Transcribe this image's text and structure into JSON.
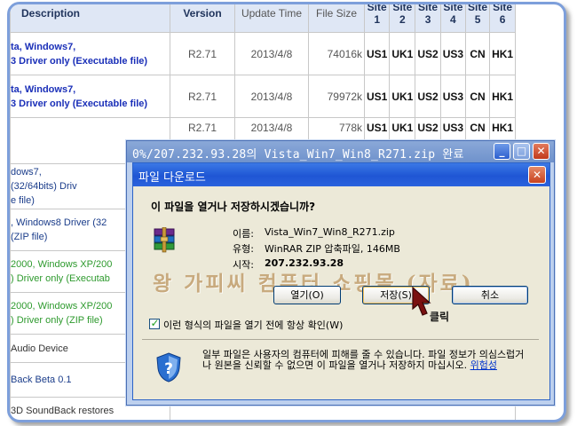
{
  "table": {
    "headers": {
      "description": "Description",
      "version": "Version",
      "date": "Update Time",
      "size": "File Size",
      "sites": [
        "Site 1",
        "Site 2",
        "Site 3",
        "Site 4",
        "Site 5",
        "Site 6"
      ]
    },
    "rows": [
      {
        "desc1": "ta, Windows7,",
        "desc2": "3 Driver only (Executable file)",
        "version": "R2.71",
        "date": "2013/4/8",
        "size": "74016k",
        "sites": [
          "US1",
          "UK1",
          "US2",
          "US3",
          "CN",
          "HK1"
        ]
      },
      {
        "desc1": "ta, Windows7,",
        "desc2": "3 Driver only (Executable file)",
        "version": "R2.71",
        "date": "2013/4/8",
        "size": "79972k",
        "sites": [
          "US1",
          "UK1",
          "US2",
          "US3",
          "CN",
          "HK1"
        ]
      },
      {
        "desc1": "",
        "desc2": "",
        "version": "R2.71",
        "date": "2013/4/8",
        "size": "778k",
        "sites": [
          "US1",
          "UK1",
          "US2",
          "US3",
          "CN",
          "HK1"
        ]
      },
      {
        "desc1": "dows7,",
        "desc2": "(32/64bits) Driv",
        "desc3": "e file)"
      },
      {
        "desc1": ", Windows8 Driver (32",
        "desc2": "(ZIP file)"
      },
      {
        "desc1": "2000, Windows XP/200",
        "desc2": ") Driver only (Executab"
      },
      {
        "desc1": "2000, Windows XP/200",
        "desc2": ") Driver only (ZIP file)"
      },
      {
        "desc1": "Audio Device"
      },
      {
        "desc1": "Back Beta 0.1"
      },
      {
        "desc1": "3D SoundBack restores"
      }
    ]
  },
  "dialog": {
    "outer_title": "0%/207.232.93.28의 Vista_Win7_Win8_R271.zip 완료",
    "title": "파일 다운로드",
    "question": "이 파일을 열거나 저장하시겠습니까?",
    "name_label": "이름:",
    "name_value": "Vista_Win7_Win8_R271.zip",
    "type_label": "유형:",
    "type_value": "WinRAR ZIP 압축파일, 146MB",
    "from_label": "시작:",
    "from_value": "207.232.93.28",
    "open_button": "열기(O)",
    "save_button": "저장(S)",
    "cancel_button": "취소",
    "checkbox_label": "이런 형식의 파일을 열기 전에 항상 확인(W)",
    "checkbox_checked": true,
    "warning_text": "일부 파일은 사용자의 컴퓨터에 피해를 줄 수 있습니다. 파일 정보가 의심스럽거나 원본을 신뢰할 수 없으면 이 파일을 열거나 저장하지 마십시오.",
    "warning_link": "위험성"
  },
  "watermark": "왕 가피씨 컴퓨터 쇼핑몰 (자료)",
  "annotation": "클릭",
  "colors": {
    "frame": "#7d9fdb",
    "titlebar": "#1f56d4",
    "dialog_bg": "#ece9d8",
    "link_blue": "#1a2fb8",
    "link_green": "#2e9a2e",
    "arrow": "#7a1010"
  }
}
